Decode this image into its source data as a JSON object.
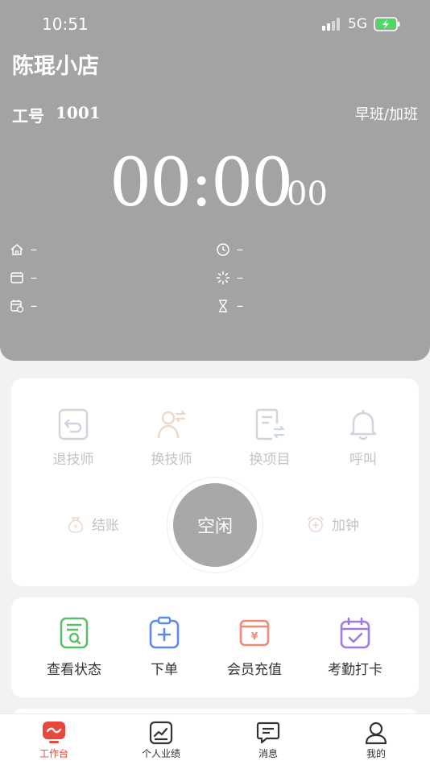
{
  "status_bar": {
    "time": "10:51",
    "network": "5G"
  },
  "header": {
    "shop_name": "陈琨小店",
    "work_no_label": "工号",
    "work_no": "1001",
    "shift": "早班/加班",
    "timer_main": "00:00",
    "timer_sec": "00",
    "info": {
      "room": "–",
      "start_time": "–",
      "card": "–",
      "progress": "–",
      "date": "–",
      "duration": "–"
    }
  },
  "operations": {
    "return_tech": "退技师",
    "change_tech": "换技师",
    "change_item": "换项目",
    "call": "呼叫",
    "checkout": "结账",
    "add_time": "加钟",
    "status": "空闲"
  },
  "quick_actions": {
    "view_status": "查看状态",
    "order": "下单",
    "recharge": "会员充值",
    "attendance": "考勤打卡"
  },
  "tabs": {
    "workbench": "工作台",
    "performance": "个人业绩",
    "messages": "消息",
    "mine": "我的"
  },
  "colors": {
    "header_bg": "#a3a3a3",
    "active_tab": "#e8483c",
    "view_status_icon": "#5bbf6a",
    "order_icon": "#5b8ae8",
    "recharge_icon": "#ee8a76",
    "attendance_icon": "#a178e6"
  }
}
